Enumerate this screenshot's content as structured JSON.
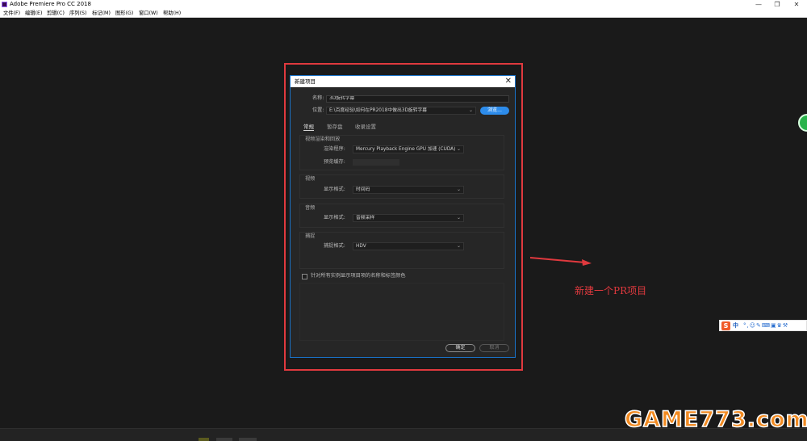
{
  "window": {
    "title": "Adobe Premiere Pro CC 2018",
    "controls": [
      "—",
      "❐",
      "✕"
    ]
  },
  "menu": [
    "文件(F)",
    "编辑(E)",
    "剪辑(C)",
    "序列(S)",
    "标记(M)",
    "图形(G)",
    "窗口(W)",
    "帮助(H)"
  ],
  "dialog": {
    "title": "新建项目",
    "name_label": "名称:",
    "name_value": "3D旋转字幕",
    "location_label": "位置:",
    "location_value": "E:\\百度经验\\如何在PR2018中做出3D旋转字幕",
    "browse_label": "浏览...",
    "tabs": [
      "常规",
      "暂存盘",
      "收录设置"
    ],
    "active_tab": "常规",
    "video_render_group": {
      "title": "视频渲染和回放",
      "renderer_label": "渲染程序:",
      "renderer_value": "Mercury Playback Engine GPU 加速 (CUDA)",
      "preview_cache_label": "预览缓存:"
    },
    "video_group": {
      "title": "视频",
      "display_format_label": "显示格式:",
      "display_format_value": "时间码"
    },
    "audio_group": {
      "title": "音频",
      "display_format_label": "显示格式:",
      "display_format_value": "音频采样"
    },
    "capture_group": {
      "title": "捕捉",
      "capture_format_label": "捕捉格式:",
      "capture_format_value": "HDV"
    },
    "checkbox_label": "针对所有实例显示项目项的名称和标签颜色",
    "checkbox_checked": false,
    "ok_label": "确定",
    "cancel_label": "取消"
  },
  "annotation": {
    "text": "新建一个PR项目",
    "color": "#e0393e"
  },
  "ime_bar": {
    "logo": "S",
    "mode": "中",
    "icons": "°,☺✎⌨▣♛⚒"
  },
  "watermark": "GAME773.com",
  "colors": {
    "highlight": "#e0393e",
    "accent": "#2d8ceb",
    "watermark": "#f18a21"
  }
}
